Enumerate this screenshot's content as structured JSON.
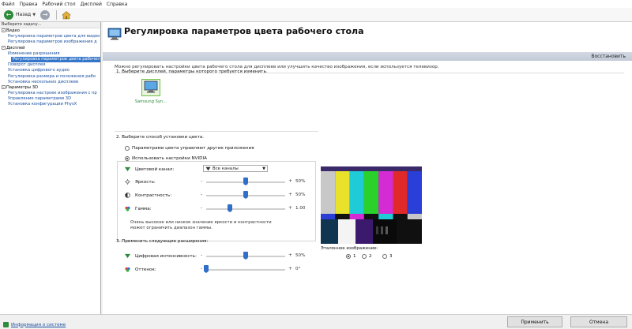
{
  "menu": [
    "Файл",
    "Правка",
    "Рабочий стол",
    "Дисплей",
    "Справка"
  ],
  "toolbar": {
    "back_label": "Назад"
  },
  "left_panel": {
    "title": "Выберите задачу...",
    "categories": [
      {
        "label": "Видео",
        "items": [
          "Регулировка параметров цвета для видео",
          "Регулировка параметров изображения д"
        ]
      },
      {
        "label": "Дисплей",
        "items": [
          "Изменение разрешения",
          "Регулировка параметров цвета рабочего",
          "Поворот дисплея",
          "Установка цифрового аудио",
          "Регулировка размера и положения рабо",
          "Установка нескольких дисплеев"
        ]
      },
      {
        "label": "Параметры 3D",
        "items": [
          "Регулировка настроек изображения с пр",
          "Управление параметрами 3D",
          "Установка конфигурации PhysX"
        ]
      }
    ]
  },
  "header": {
    "title": "Регулировка параметров цвета рабочего стола",
    "restore": "Восстановить",
    "description": "Можно регулировать настройки цвета рабочего стола для дисплеев или улучшить качество изображения, если используется телевизор."
  },
  "step1": {
    "label": "1. Выберите дисплей, параметры которого требуется изменить.",
    "display_name": "Samsung Syn..."
  },
  "step2": {
    "label": "2. Выберите способ установки цвета.",
    "option_other": "Параметрами цвета управляют другие приложения",
    "option_nvidia": "Использовать настройки NVIDIA",
    "channel_label": "Цветовой канал:",
    "channel_value": "Все каналы",
    "brightness": {
      "label": "Яркость:",
      "value": "50%",
      "level": 0.5
    },
    "contrast": {
      "label": "Контрастность:",
      "value": "50%",
      "level": 0.5
    },
    "gamma": {
      "label": "Гамма:",
      "value": "1.00",
      "level": 0.3
    },
    "note_line1": "Очень высокое или низкое значение яркости и контрастности",
    "note_line2": "может ограничить диапазон гаммы."
  },
  "step3": {
    "label": "3. Применить следующие расширения:",
    "intensity": {
      "label": "Цифровая интенсивность:",
      "value": "50%",
      "level": 0.5
    },
    "hue": {
      "label": "Оттенок:",
      "value": "0°",
      "level": 0.0
    }
  },
  "reference": {
    "label": "Эталонное изображение:",
    "options": [
      "1",
      "2",
      "3"
    ],
    "selected": "1"
  },
  "footer": {
    "system_info": "Информация о системе",
    "apply": "Применить",
    "cancel": "Отмена"
  },
  "colors": {
    "accent": "#3476c9",
    "nvidia_green": "#2e8b3c",
    "slider": "#2f6fc9"
  }
}
